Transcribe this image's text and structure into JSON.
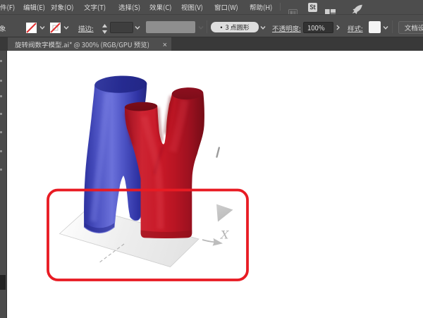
{
  "colors": {
    "ui_bar": "#4d4d4d",
    "tab_bar": "#393939",
    "canvas": "#ffffff",
    "annotation_red": "#e81b23",
    "tube_blue": "#3f45b8",
    "tube_red": "#c41626"
  },
  "menubar": {
    "items": [
      {
        "label": "件(F)"
      },
      {
        "label": "编辑(E)"
      },
      {
        "label": "对象(O)"
      },
      {
        "label": "文字(T)"
      },
      {
        "label": "选择(S)"
      },
      {
        "label": "效果(C)"
      },
      {
        "label": "视图(V)"
      },
      {
        "label": "窗口(W)"
      },
      {
        "label": "帮助(H)"
      }
    ],
    "stock_label": "St"
  },
  "controlbar": {
    "selection_fragment": "象",
    "stroke_label": "描边:",
    "brush_bullet": "•",
    "brush_name": "3 点圆形",
    "opacity_label": "不透明度:",
    "opacity_value": "100%",
    "style_label": "样式:",
    "doc_setup_label": "文档设"
  },
  "tabbar": {
    "title": "旋转阀数字模型.ai* @ 300% (RGB/GPU 预览)",
    "close_label": "×"
  },
  "canvas": {
    "axis_label": "X"
  }
}
